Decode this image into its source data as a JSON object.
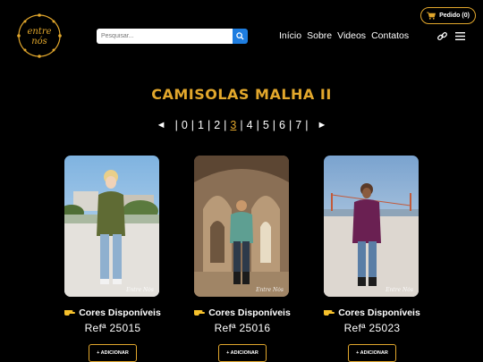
{
  "header": {
    "logo_text_line1": "entre",
    "logo_text_line2": "nós",
    "search": {
      "placeholder": "Pesquisar..."
    },
    "nav": [
      "Início",
      "Sobre",
      "Videos",
      "Contatos"
    ],
    "cart_label": "Pedido (0)"
  },
  "page": {
    "title": "CAMISOLAS MALHA II"
  },
  "pagination": {
    "prev_icon": "◄",
    "next_icon": "►",
    "pages": [
      "0",
      "1",
      "2",
      "3",
      "4",
      "5",
      "6",
      "7"
    ],
    "active": "3"
  },
  "products": [
    {
      "colors_label": "Cores Disponíveis",
      "ref": "Refª 25015",
      "add_label": "+ ADICIONAR",
      "watermark": "Entre Nós",
      "sweater_color": "#5f6b34"
    },
    {
      "colors_label": "Cores Disponíveis",
      "ref": "Refª 25016",
      "add_label": "+ ADICIONAR",
      "watermark": "Entre Nós",
      "sweater_color": "#5e9f92"
    },
    {
      "colors_label": "Cores Disponíveis",
      "ref": "Refª 25023",
      "add_label": "+ ADICIONAR",
      "watermark": "Entre Nós",
      "sweater_color": "#6a2052"
    }
  ],
  "colors": {
    "accent": "#e2a72c",
    "search_button": "#1e7de0",
    "background": "#000000"
  }
}
